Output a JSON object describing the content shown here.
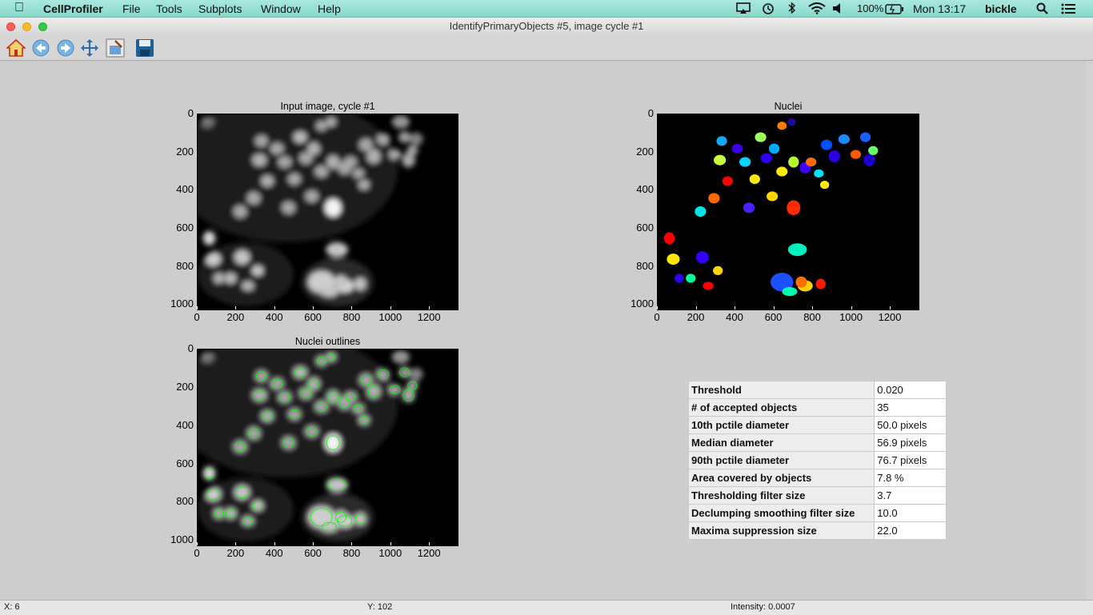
{
  "menubar": {
    "app": "CellProfiler",
    "menus": [
      "File",
      "Tools",
      "Subplots",
      "Window",
      "Help"
    ],
    "battery": "100%",
    "clock": "Mon 13:17",
    "user": "bickle"
  },
  "window": {
    "title": "IdentifyPrimaryObjects #5, image cycle #1"
  },
  "toolbar": {
    "buttons": [
      "home-icon",
      "back-icon",
      "forward-icon",
      "pan-icon",
      "configure-subplots-icon",
      "save-icon"
    ]
  },
  "plots": {
    "input": {
      "title": "Input image, cycle #1"
    },
    "nuclei": {
      "title": "Nuclei"
    },
    "outlines": {
      "title": "Nuclei outlines"
    },
    "x_ticks": [
      "0",
      "200",
      "400",
      "600",
      "800",
      "1000",
      "1200"
    ],
    "y_ticks": [
      "0",
      "200",
      "400",
      "600",
      "800",
      "1000"
    ],
    "x_range": [
      0,
      1344
    ],
    "y_range": [
      0,
      1024
    ]
  },
  "stats": {
    "rows": [
      {
        "label": "Threshold",
        "value": "0.020"
      },
      {
        "label": "# of accepted objects",
        "value": "35"
      },
      {
        "label": "10th pctile diameter",
        "value": "50.0 pixels"
      },
      {
        "label": "Median diameter",
        "value": "56.9 pixels"
      },
      {
        "label": "90th pctile diameter",
        "value": "76.7 pixels"
      },
      {
        "label": "Area covered by objects",
        "value": "7.8 %"
      },
      {
        "label": "Thresholding filter size",
        "value": "3.7"
      },
      {
        "label": "Declumping smoothing filter size",
        "value": "10.0"
      },
      {
        "label": "Maxima suppression size",
        "value": "22.0"
      }
    ]
  },
  "status": {
    "x": "X: 6",
    "y": "Y: 102",
    "intensity": "Intensity: 0.0007"
  },
  "colors": {
    "menubar": "#9fe3d8",
    "outline": "#00ff00"
  }
}
